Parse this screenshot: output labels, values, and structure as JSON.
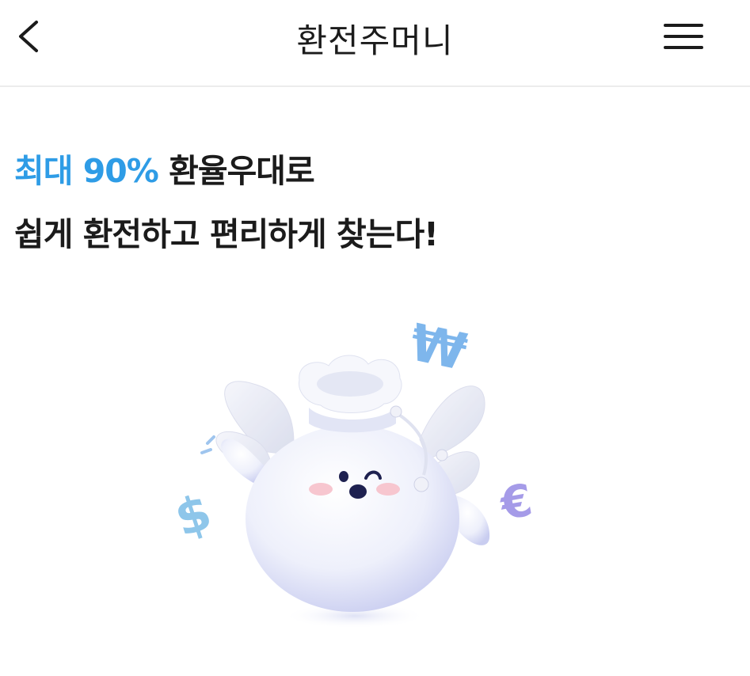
{
  "header": {
    "title": "환전주머니",
    "back_icon": "chevron-left-icon",
    "menu_icon": "hamburger-menu-icon"
  },
  "promo": {
    "highlight": "최대 90%",
    "line1_rest": " 환율우대로",
    "line2": "쉽게 환전하고 편리하게 찾는다!"
  },
  "hero": {
    "illustration": "winged-money-pouch-mascot",
    "currency_symbols": [
      "₩",
      "$",
      "€"
    ]
  },
  "colors": {
    "accent": "#2e9ce6",
    "text": "#1b1b1b",
    "divider": "#ececec",
    "won_symbol": "#7eb6ec",
    "dollar_symbol": "#8ec6ea",
    "euro_symbol": "#a59be8"
  }
}
